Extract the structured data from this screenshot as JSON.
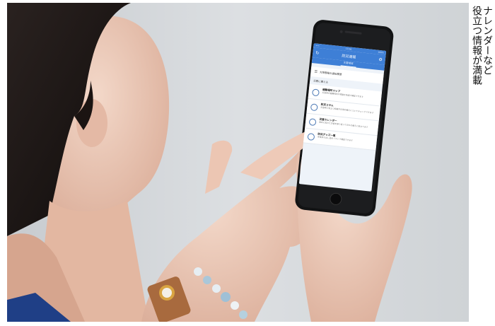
{
  "phone": {
    "status_left": "•••",
    "status_time": "17:06",
    "status_right": "100%",
    "title": "防災速報",
    "tab": "主要地域",
    "history_label": "大雨警報の通知履歴",
    "section_label": "災害に備える",
    "menu": [
      {
        "title": "避難場所マップ",
        "desc": "災害時の避難場所や経路を地図で確認できます"
      },
      {
        "title": "防災コラム",
        "desc": "災害時に役立つ知識や日頃の備えについてチェックできます"
      },
      {
        "title": "災害カレンダー",
        "desc": "過去に起きた災害を振り返って日々の備えに役立てます"
      },
      {
        "title": "防災グッズ一覧",
        "desc": "非常持ち出し品をリストで確認できます"
      }
    ]
  },
  "caption": {
    "line1": "ナレンダーなど",
    "line2": "役立つ情報が満載"
  }
}
